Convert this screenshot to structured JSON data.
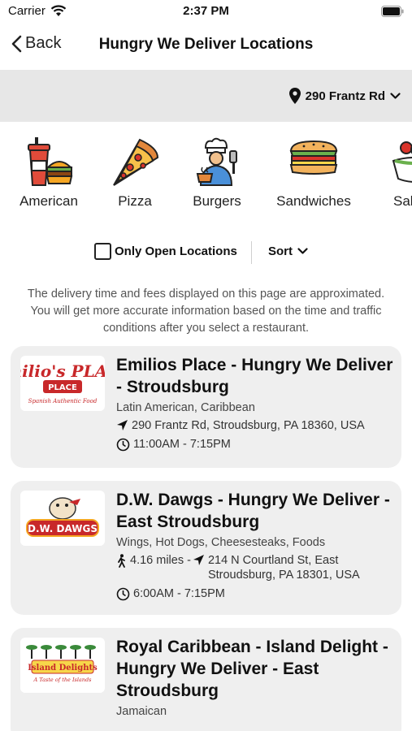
{
  "status_bar": {
    "carrier": "Carrier",
    "time": "2:37 PM"
  },
  "nav": {
    "back_label": "Back",
    "title": "Hungry We Deliver Locations"
  },
  "location": {
    "address": "290 Frantz Rd"
  },
  "categories": [
    {
      "label": "American",
      "icon": "soda-burger-icon"
    },
    {
      "label": "Pizza",
      "icon": "pizza-slice-icon"
    },
    {
      "label": "Burgers",
      "icon": "chef-icon"
    },
    {
      "label": "Sandwiches",
      "icon": "sandwich-icon"
    },
    {
      "label": "Salads",
      "icon": "salad-bowl-icon"
    }
  ],
  "filters": {
    "open_only_label": "Only Open Locations",
    "open_only_checked": false,
    "sort_label": "Sort"
  },
  "disclaimer": "The delivery time and fees displayed on this page are approximated. You will get more accurate information based on the time and traffic conditions after you select a restaurant.",
  "restaurants": [
    {
      "name": "Emilios Place - Hungry We Deliver - Stroudsburg",
      "cuisine": "Latin American, Caribbean",
      "distance": "",
      "address": "290 Frantz Rd, Stroudsburg, PA 18360, USA",
      "hours": "11:00AM - 7:15PM",
      "logo_text": "Emilio's PLACE",
      "logo_subtext": "Spanish Authentic Food"
    },
    {
      "name": "D.W. Dawgs - Hungry We Deliver - East Stroudsburg",
      "cuisine": "Wings, Hot Dogs, Cheesesteaks, Foods",
      "distance": "4.16 miles -",
      "address": "214 N Courtland St, East Stroudsburg, PA 18301, USA",
      "hours": "6:00AM - 7:15PM",
      "logo_text": "D.W. DAWGS"
    },
    {
      "name": "Royal Caribbean - Island Delight - Hungry We Deliver - East Stroudsburg",
      "cuisine": "Jamaican",
      "logo_text": "Island Delights",
      "logo_subtext": "A Taste of the Islands"
    }
  ],
  "colors": {
    "location_bar_bg": "#e7e7e7",
    "card_bg": "#efefef"
  }
}
